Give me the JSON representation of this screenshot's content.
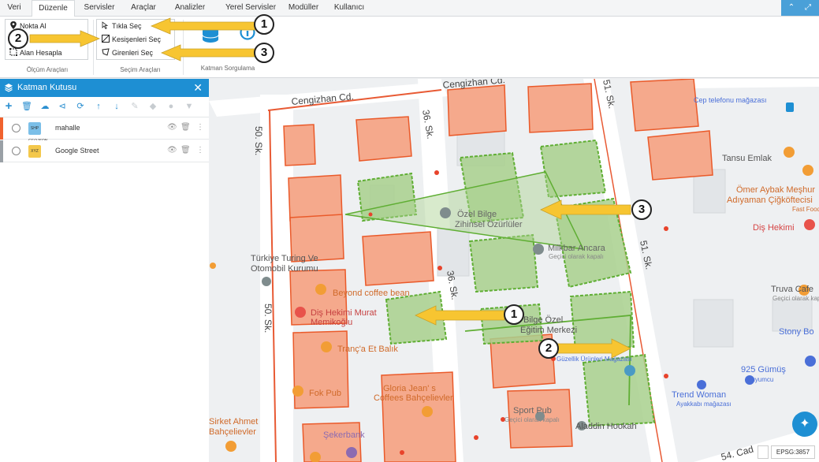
{
  "menu": {
    "tabs": [
      "Veri",
      "Düzenle",
      "Servisler",
      "Araçlar",
      "Analizler",
      "Yerel Servisler",
      "Modüller",
      "Kullanıcı"
    ],
    "active": "Düzenle"
  },
  "ribbon": {
    "measure": {
      "items": [
        "Nokta Al",
        "Alan Hesapla"
      ],
      "group_label": "Ölçüm Araçları"
    },
    "select": {
      "items": [
        "Tıkla Seç",
        "Kesişenleri Seç",
        "Girenleri Seç"
      ],
      "group_label": "Seçim Araçları"
    },
    "layer_query": {
      "group_label": "Katman Sorgulama"
    }
  },
  "callouts": [
    "1",
    "2",
    "3"
  ],
  "layer_panel": {
    "title": "Katman Kutusu",
    "layers": [
      {
        "name": "mahalle",
        "thumb": "SHP GEOJSON",
        "color": "#f0622e"
      },
      {
        "name": "Google Street",
        "thumb": "XYZ",
        "color": "#9aa0a6"
      }
    ]
  },
  "map": {
    "streets": [
      "Cengizhan Cd.",
      "Cengizhan Cd.",
      "36. Sk.",
      "36. Sk.",
      "50. Sk.",
      "50. Sk.",
      "51. Sk.",
      "51. Sk.",
      "54. Cad"
    ],
    "pois": [
      "Cep telefonu mağazası",
      "Tansu Emlak",
      "Ömer Aybak Meşhur",
      "Adıyaman Çiğköftecisi",
      "Fast Food",
      "Diş Hekimi",
      "Özel Bilge",
      "Zihinsel Özürlüler",
      "Milkbar Ancara",
      "Geçici olarak kapalı",
      "Türkiye Turing Ve",
      "Otomobil Kurumu",
      "Beyond coffee bean",
      "Diş Hekimi Murat",
      "Memikoğlu",
      "Bilge Özel",
      "Eğitim Merkezi",
      "Truva Cafe",
      "Geçici olarak kapalı",
      "Stony Bo",
      "Tranç'a Et Balık",
      "Fok Pub",
      "Gloria Jean' s",
      "Coffees Bahçelievler",
      "Sport Pub",
      "Geçici olarak kapalı",
      "Aladdin Hookah",
      "925 Gümüş",
      "Kuyumcu",
      "Trend Woman",
      "Ayakkabı mağazası",
      "Güzellik Ürünleri Mağazası",
      "Şekerbank",
      "Sirket Ahmet",
      "Bahçelievler"
    ],
    "crs": "EPSG:3857"
  },
  "colors": {
    "accent": "#1e8fd3",
    "parcel_fill": "#f5a98c",
    "parcel_stroke": "#ea5a2a",
    "selected_fill": "#a8d08d",
    "selected_stroke": "#5fae33",
    "arrow": "#f7c531"
  },
  "icons": [
    "gear-icon",
    "layers-icon",
    "close-icon",
    "plus-icon",
    "trash-icon",
    "eye-icon",
    "more-icon",
    "pin-icon"
  ]
}
